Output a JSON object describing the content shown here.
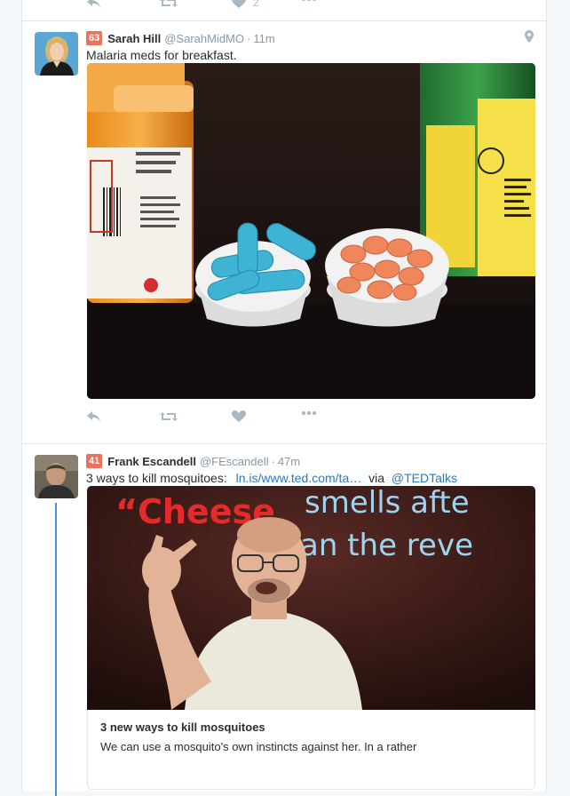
{
  "top_tweet": {
    "like_count": "2"
  },
  "tweets": [
    {
      "score": "63",
      "fullname": "Sarah Hill",
      "handle": "@SarahMidMO",
      "time": "11m",
      "text": "Malaria meds for breakfast.",
      "media_icon": "photo-pill-bottles",
      "geo_icon": "location-pin-icon"
    },
    {
      "score": "41",
      "fullname": "Frank Escandell",
      "handle": "@FEscandell",
      "time": "47m",
      "text_prefix": "3 ways to kill mosquitoes:",
      "link": "ln.is/www.ted.com/ta…",
      "via": "via",
      "mention": "@TEDTalks",
      "media_caption": "“Cheese smells after… than the reve…",
      "card_title": "3 new ways to kill mosquitoes",
      "card_desc": "We can use a mosquito's own instincts against her. In a rather"
    }
  ],
  "colors": {
    "link": "#2b7bb9",
    "score": "#e8735f",
    "thread": "#4a90d9"
  }
}
